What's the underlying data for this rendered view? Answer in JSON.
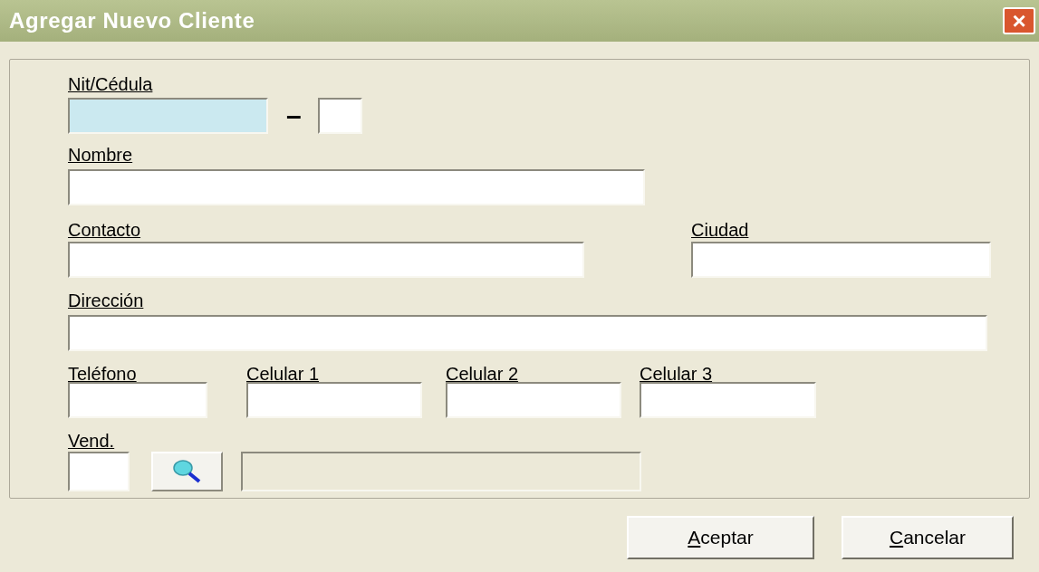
{
  "window": {
    "title": "Agregar Nuevo Cliente",
    "close_glyph": "×"
  },
  "form": {
    "nit": {
      "label": "Nit/Cédula",
      "focused": true
    },
    "separator": "–",
    "nit_check_digit": {
      "focused": false
    },
    "nombre": {
      "label": "Nombre",
      "focused": false
    },
    "contacto": {
      "label": "Contacto",
      "focused": false
    },
    "ciudad": {
      "label": "Ciudad",
      "focused": false
    },
    "direccion": {
      "label": "Dirección",
      "focused": false
    },
    "phones": [
      {
        "label": "Teléfono",
        "focused": false
      },
      {
        "label": "Celular 1",
        "focused": false
      },
      {
        "label": "Celular 2",
        "focused": false
      },
      {
        "label": "Celular 3",
        "focused": false
      }
    ],
    "vendedor": {
      "label": "Vend.",
      "focused": false
    },
    "vendedor_nombre": {
      "disabled": true
    }
  },
  "buttons": [
    {
      "mnemonic": "A",
      "rest": "ceptar"
    },
    {
      "mnemonic": "C",
      "rest": "ancelar"
    }
  ]
}
